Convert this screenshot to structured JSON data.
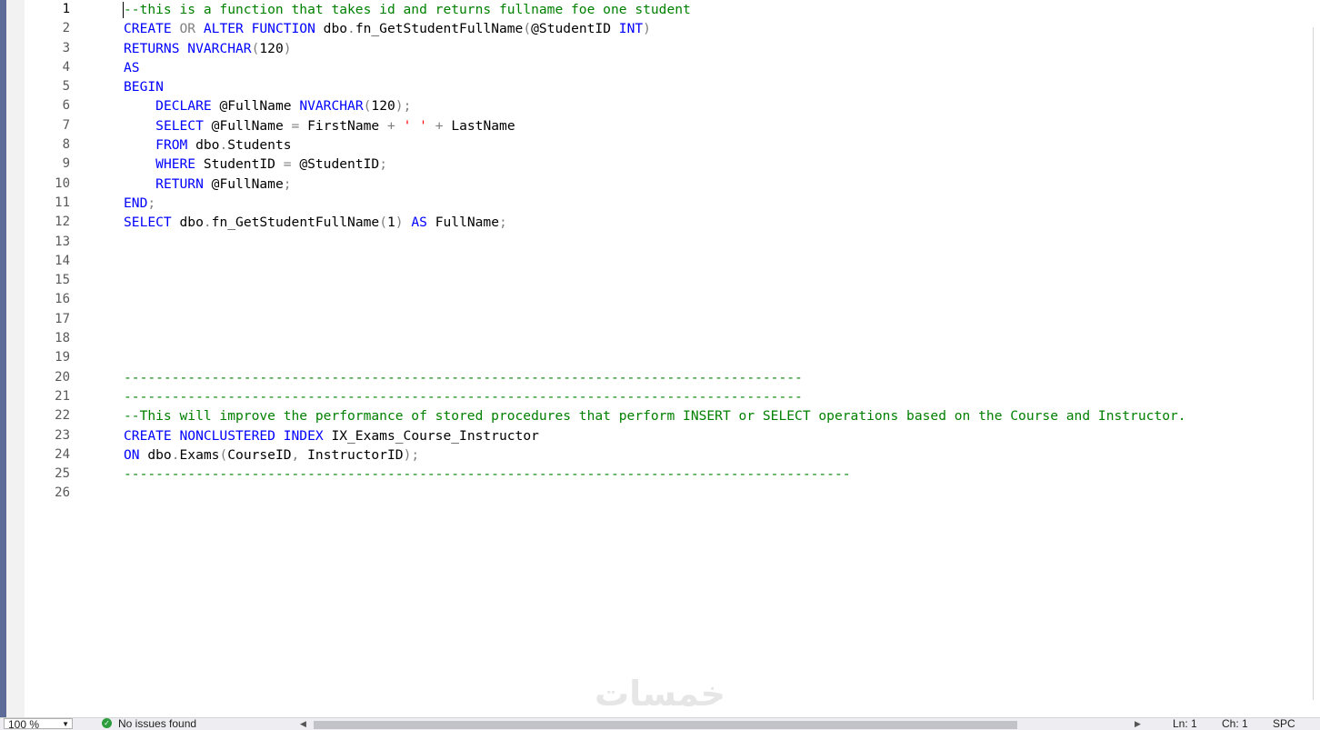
{
  "editor": {
    "line_numbers": [
      "1",
      "2",
      "3",
      "4",
      "5",
      "6",
      "7",
      "8",
      "9",
      "10",
      "11",
      "12",
      "13",
      "14",
      "15",
      "16",
      "17",
      "18",
      "19",
      "20",
      "21",
      "22",
      "23",
      "24",
      "25",
      "26"
    ],
    "current_line": "1",
    "lines": [
      [
        {
          "t": "--this is a function that takes id and returns fullname foe one student",
          "c": "cm"
        }
      ],
      [
        {
          "t": "CREATE ",
          "c": "kw"
        },
        {
          "t": "OR ",
          "c": "gray"
        },
        {
          "t": "ALTER FUNCTION ",
          "c": "kw"
        },
        {
          "t": "dbo",
          "c": ""
        },
        {
          "t": ".",
          "c": "gray"
        },
        {
          "t": "fn_GetStudentFullName",
          "c": ""
        },
        {
          "t": "(",
          "c": "gray"
        },
        {
          "t": "@StudentID ",
          "c": ""
        },
        {
          "t": "INT",
          "c": "kw"
        },
        {
          "t": ")",
          "c": "gray"
        }
      ],
      [
        {
          "t": "RETURNS ",
          "c": "kw"
        },
        {
          "t": "NVARCHAR",
          "c": "kw"
        },
        {
          "t": "(",
          "c": "gray"
        },
        {
          "t": "120",
          "c": ""
        },
        {
          "t": ")",
          "c": "gray"
        }
      ],
      [
        {
          "t": "AS",
          "c": "kw"
        }
      ],
      [
        {
          "t": "BEGIN",
          "c": "kw"
        }
      ],
      [
        {
          "t": "    ",
          "c": ""
        },
        {
          "t": "DECLARE ",
          "c": "kw"
        },
        {
          "t": "@FullName ",
          "c": ""
        },
        {
          "t": "NVARCHAR",
          "c": "kw"
        },
        {
          "t": "(",
          "c": "gray"
        },
        {
          "t": "120",
          "c": ""
        },
        {
          "t": ");",
          "c": "gray"
        }
      ],
      [
        {
          "t": "    ",
          "c": ""
        },
        {
          "t": "SELECT ",
          "c": "kw"
        },
        {
          "t": "@FullName ",
          "c": ""
        },
        {
          "t": "= ",
          "c": "gray"
        },
        {
          "t": "FirstName ",
          "c": ""
        },
        {
          "t": "+ ",
          "c": "gray"
        },
        {
          "t": "' ' ",
          "c": "str"
        },
        {
          "t": "+ ",
          "c": "gray"
        },
        {
          "t": "LastName",
          "c": ""
        }
      ],
      [
        {
          "t": "    ",
          "c": ""
        },
        {
          "t": "FROM ",
          "c": "kw"
        },
        {
          "t": "dbo",
          "c": ""
        },
        {
          "t": ".",
          "c": "gray"
        },
        {
          "t": "Students",
          "c": ""
        }
      ],
      [
        {
          "t": "    ",
          "c": ""
        },
        {
          "t": "WHERE ",
          "c": "kw"
        },
        {
          "t": "StudentID ",
          "c": ""
        },
        {
          "t": "= ",
          "c": "gray"
        },
        {
          "t": "@StudentID",
          "c": ""
        },
        {
          "t": ";",
          "c": "gray"
        }
      ],
      [
        {
          "t": "    ",
          "c": ""
        },
        {
          "t": "RETURN ",
          "c": "kw"
        },
        {
          "t": "@FullName",
          "c": ""
        },
        {
          "t": ";",
          "c": "gray"
        }
      ],
      [
        {
          "t": "END",
          "c": "kw"
        },
        {
          "t": ";",
          "c": "gray"
        }
      ],
      [
        {
          "t": "SELECT ",
          "c": "kw"
        },
        {
          "t": "dbo",
          "c": ""
        },
        {
          "t": ".",
          "c": "gray"
        },
        {
          "t": "fn_GetStudentFullName",
          "c": ""
        },
        {
          "t": "(",
          "c": "gray"
        },
        {
          "t": "1",
          "c": ""
        },
        {
          "t": ") ",
          "c": "gray"
        },
        {
          "t": "AS ",
          "c": "kw"
        },
        {
          "t": "FullName",
          "c": ""
        },
        {
          "t": ";",
          "c": "gray"
        }
      ],
      [],
      [],
      [],
      [],
      [],
      [],
      [],
      [
        {
          "t": "-------------------------------------------------------------------------------------",
          "c": "cm"
        }
      ],
      [
        {
          "t": "-------------------------------------------------------------------------------------",
          "c": "cm"
        }
      ],
      [
        {
          "t": "--This will improve the performance of stored procedures that perform INSERT or SELECT operations based on the Course and Instructor.",
          "c": "cm"
        }
      ],
      [
        {
          "t": "CREATE NONCLUSTERED INDEX ",
          "c": "kw"
        },
        {
          "t": "IX_Exams_Course_Instructor",
          "c": ""
        }
      ],
      [
        {
          "t": "ON ",
          "c": "kw"
        },
        {
          "t": "dbo",
          "c": ""
        },
        {
          "t": ".",
          "c": "gray"
        },
        {
          "t": "Exams",
          "c": ""
        },
        {
          "t": "(",
          "c": "gray"
        },
        {
          "t": "CourseID",
          "c": ""
        },
        {
          "t": ", ",
          "c": "gray"
        },
        {
          "t": "InstructorID",
          "c": ""
        },
        {
          "t": ");",
          "c": "gray"
        }
      ],
      [
        {
          "t": "-------------------------------------------------------------------------------------------",
          "c": "cm"
        }
      ],
      []
    ]
  },
  "statusbar": {
    "zoom": "100 %",
    "issues_icon": "check-circle-icon",
    "issues_text": "No issues found",
    "ln": "Ln: 1",
    "ch": "Ch: 1",
    "spc": "SPC"
  },
  "watermark": {
    "text": "خمسات"
  },
  "colors": {
    "keyword": "#0000ff",
    "operator": "#808080",
    "comment": "#008000",
    "string": "#ff0000"
  }
}
